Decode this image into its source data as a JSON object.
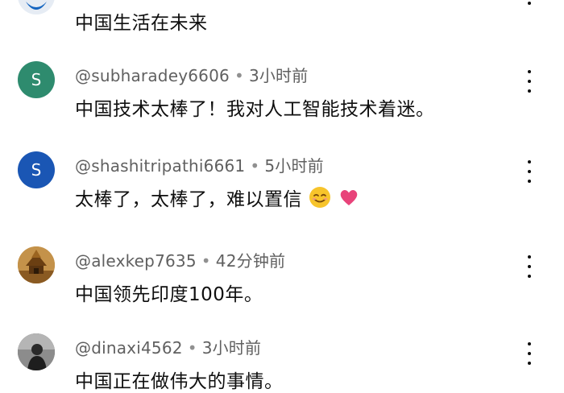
{
  "comments": [
    {
      "avatar_letter": "",
      "handle": "",
      "time": "",
      "text": "中国生活在未来",
      "avatar_color": "#1565c0"
    },
    {
      "avatar_letter": "S",
      "handle": "@subharadey6606",
      "time": "3小时前",
      "text": "中国技术太棒了！我对人工智能技术着迷。",
      "avatar_color": "#2e8b6e"
    },
    {
      "avatar_letter": "S",
      "handle": "@shashitripathi6661",
      "time": "5小时前",
      "text": "太棒了，太棒了，难以置信",
      "avatar_color": "#1a56b4",
      "emojis": [
        "smiling-face-emoji",
        "heart-emoji"
      ]
    },
    {
      "avatar_letter": "",
      "handle": "@alexkep7635",
      "time": "42分钟前",
      "text": "中国领先印度100年。",
      "avatar_color": "#b07a2c"
    },
    {
      "avatar_letter": "",
      "handle": "@dinaxi4562",
      "time": "3小时前",
      "text": "中国正在做伟大的事情。",
      "avatar_color": "#5a5a5a"
    }
  ],
  "separator": "•"
}
